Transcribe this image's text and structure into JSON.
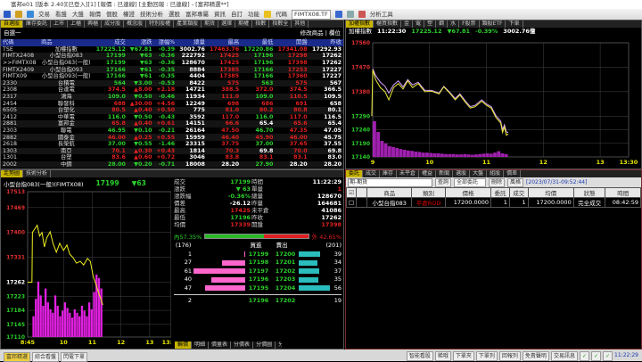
{
  "window": {
    "title": "富邦e01 [版本 2.40][已登入][1] [報價 : 已連線] [主動回報 : 已連線] - [富邦精選**]"
  },
  "toolbar": {
    "menus": [
      "交易",
      "看盤",
      "大盤",
      "報價",
      "個股",
      "權證",
      "技術分析",
      "選股",
      "富邦專屬",
      "資訊",
      "自訂",
      "功能"
    ],
    "code_label": "代碼",
    "code_value": "FIMTX08.TF",
    "analysis_tool": "分析工具"
  },
  "quote_panel": {
    "tabs": [
      "自選股",
      "庫存委託",
      "上市",
      "上櫃",
      "興櫃",
      "成分股",
      "概念股",
      "特別股權",
      "產業類股",
      "期貨",
      "選擇",
      "期權",
      "指數",
      "指數全",
      "其他"
    ],
    "group": "自選一",
    "edit_label": "修改商品",
    "col_label": "欄位",
    "columns": [
      "代碼",
      "商品",
      "成交",
      "漲跌",
      "漲幅%",
      "總量",
      "最高",
      "最低",
      "開盤",
      "昨收"
    ],
    "rows": [
      [
        "TSE",
        "加權指數",
        "17225.12",
        "▼67.81",
        "-0.39",
        "3002.76",
        "17463.76",
        "17220.86",
        "17341.08",
        "17292.93"
      ],
      [
        "FIMTX2408",
        "小型台指083",
        "17199",
        "▼63",
        "-0.36",
        "222792",
        "17425",
        "17196",
        "17298",
        "17262"
      ],
      [
        ">>FIMTX08",
        "小型台指083(一般)",
        "17199",
        "▼63",
        "-0.36",
        "128670",
        "17425",
        "17196",
        "17398",
        "17262"
      ],
      [
        "FIMTX2409",
        "小型台指093",
        "17166",
        "▼61",
        "-0.35",
        "8884",
        "17385",
        "17166",
        "17253",
        "17227"
      ],
      [
        "FIMTX09",
        "小型台指093(一般)",
        "17166",
        "▼61",
        "-0.35",
        "4404",
        "17385",
        "17166",
        "17360",
        "17227"
      ],
      [
        "2330",
        "台積電",
        "564",
        "▼3.00",
        "-0.53",
        "8422",
        "575",
        "563",
        "575",
        "567"
      ],
      [
        "2308",
        "台達電",
        "374.5",
        "▲8.00",
        "+2.18",
        "14721",
        "388.5",
        "372.0",
        "374.5",
        "366.5"
      ],
      [
        "2317",
        "鴻海",
        "109.0",
        "▼0.50",
        "-0.46",
        "11934",
        "111.0",
        "109.0",
        "110.5",
        "109.5"
      ],
      [
        "2454",
        "聯發科",
        "688",
        "▲30.00",
        "+4.56",
        "12249",
        "698",
        "686",
        "691",
        "658"
      ],
      [
        "6505",
        "台塑化",
        "80.5",
        "▲0.40",
        "+0.50",
        "775",
        "81.0",
        "80.2",
        "80.8",
        "80.1"
      ],
      [
        "2412",
        "中華電",
        "116.0",
        "▼0.50",
        "-0.43",
        "3592",
        "117.0",
        "116.0",
        "117.0",
        "116.5"
      ],
      [
        "2881",
        "富邦金",
        "65.8",
        "▲0.40",
        "+0.61",
        "14151",
        "66.6",
        "65.4",
        "65.6",
        "65.4"
      ],
      [
        "2303",
        "聯電",
        "46.95",
        "▼0.10",
        "-0.21",
        "26164",
        "47.50",
        "46.70",
        "47.35",
        "47.05"
      ],
      [
        "2882",
        "國泰金",
        "46.00",
        "▲0.25",
        "+0.55",
        "15959",
        "46.40",
        "45.90",
        "46.00",
        "45.75"
      ],
      [
        "2618",
        "長榮航",
        "37.00",
        "▼0.55",
        "-1.46",
        "23315",
        "37.75",
        "37.00",
        "37.65",
        "37.55"
      ],
      [
        "1303",
        "南亞",
        "70.1",
        "▲0.30",
        "+0.43",
        "1814",
        "70.3",
        "69.8",
        "70.0",
        "69.8"
      ],
      [
        "1301",
        "台塑",
        "83.6",
        "▲0.60",
        "+0.72",
        "3046",
        "83.8",
        "83.1",
        "83.1",
        "83.0"
      ],
      [
        "2002",
        "中鋼",
        "28.00",
        "▼0.20",
        "-0.71",
        "18008",
        "28.20",
        "27.90",
        "28.20",
        "28.20"
      ]
    ]
  },
  "index_panel": {
    "tabs": [
      "加權指數",
      "櫃買指數",
      "金",
      "電",
      "塑",
      "鋼",
      "水",
      "F股票",
      "類股ETF",
      "下單"
    ],
    "name": "加權指數",
    "time": "11:22:30",
    "price": "17225.12",
    "change": "▼67.81",
    "pct": "-0.39%",
    "volume": "3002.76億"
  },
  "detail_panel": {
    "tabs": [
      "走勢圖",
      "技術分析"
    ],
    "symbol": "小型台指083(一般)(FIMTX08)",
    "price": "17199",
    "change": "▼63",
    "fields": [
      [
        "成交",
        "17199",
        "時間",
        "11:22:29"
      ],
      [
        "漲跌",
        "▼ 63",
        "單量",
        "1"
      ],
      [
        "漲跌幅",
        "-0.36%",
        "總量",
        "128670"
      ],
      [
        "價差",
        "-26.12",
        "昨量",
        "164681"
      ],
      [
        "最高",
        "17425",
        "未平倉",
        "41086"
      ],
      [
        "最低",
        "17196",
        "昨收",
        "17262"
      ],
      [
        "均價",
        "17339",
        "開盤",
        "17398"
      ]
    ],
    "inner_pct": "內57.35%",
    "outer_pct": "外 42.65%",
    "inner_ratio": 57.35,
    "book_header": [
      "(176)",
      "買進",
      "賣出",
      "(201)"
    ],
    "book": [
      [
        "1",
        "17199",
        "17200",
        "39"
      ],
      [
        "27",
        "17198",
        "17201",
        "34"
      ],
      [
        "61",
        "17197",
        "17202",
        "37"
      ],
      [
        "40",
        "17196",
        "17203",
        "35"
      ],
      [
        "47",
        "17195",
        "17204",
        "56"
      ]
    ],
    "book_total": [
      "2",
      "17196",
      "17202",
      "19"
    ],
    "bottom_tabs": [
      "輪價",
      "明細",
      "價量表",
      "分價表",
      "分價圖",
      "分量表",
      "支撐壓力",
      "五"
    ]
  },
  "order_panel": {
    "tabs": [
      "委託",
      "成交",
      "庫存",
      "未平倉",
      "權益",
      "新聞",
      "選股",
      "大盤",
      "組股",
      "價差"
    ],
    "account_label": "期-期貨",
    "query": "查詢",
    "filter": "全部委託",
    "delete": "刪除",
    "style": "風格",
    "timestamp": "[2023/07/31-09:52:44]",
    "columns": [
      "商品",
      "類別",
      "價格",
      "委託",
      "成交",
      "均價",
      "狀態",
      "時間"
    ],
    "rows": [
      [
        "小型台指083",
        "平倉ROD",
        "17200.0000",
        "1",
        "1",
        "17200.0000",
        "完全成交",
        "08:42:59"
      ]
    ]
  },
  "status": {
    "tabs": [
      "富邦精選",
      "綜合看盤",
      "閃電下單"
    ],
    "buttons": [
      "智能看股",
      "稀哦",
      "下單夾",
      "下單列",
      "回報列",
      "免責聲明",
      "交易訊息"
    ],
    "clock": "11:22:29"
  },
  "chart_data": [
    {
      "type": "line",
      "panel": "index",
      "x_ticks": [
        "9",
        "10",
        "11",
        "12",
        "13",
        "13:30"
      ],
      "y_ticks": [
        17560,
        17470,
        17380,
        17290,
        17240,
        17190,
        17140
      ],
      "ylim": [
        17140,
        17560
      ],
      "prev_close": 17292.93,
      "series": [
        {
          "color": "#e8e83a",
          "points": [
            [
              "8:59",
              17290
            ],
            [
              "9:00",
              17460
            ],
            [
              "9:03",
              17425
            ],
            [
              "9:08",
              17395
            ],
            [
              "9:13",
              17380
            ],
            [
              "9:17",
              17350
            ],
            [
              "9:22",
              17395
            ],
            [
              "9:27",
              17410
            ],
            [
              "9:32",
              17390
            ],
            [
              "9:37",
              17420
            ],
            [
              "9:42",
              17395
            ],
            [
              "9:48",
              17410
            ],
            [
              "9:55",
              17380
            ],
            [
              "10:02",
              17382
            ],
            [
              "10:10",
              17372
            ],
            [
              "10:15",
              17398
            ],
            [
              "10:22",
              17372
            ],
            [
              "10:27",
              17350
            ],
            [
              "10:32",
              17368
            ],
            [
              "10:38",
              17340
            ],
            [
              "10:43",
              17320
            ],
            [
              "10:48",
              17325
            ],
            [
              "10:55",
              17345
            ],
            [
              "11:00",
              17330
            ],
            [
              "11:05",
              17320
            ],
            [
              "11:10",
              17285
            ],
            [
              "11:15",
              17265
            ],
            [
              "11:17",
              17230
            ],
            [
              "11:19",
              17250
            ],
            [
              "11:21",
              17220
            ],
            [
              "11:23",
              17225
            ]
          ]
        },
        {
          "color": "#d9a3ff",
          "points": [
            [
              "9:00",
              17465
            ],
            [
              "9:03",
              17440
            ],
            [
              "9:08",
              17415
            ],
            [
              "9:13",
              17400
            ],
            [
              "9:17",
              17375
            ],
            [
              "9:22",
              17405
            ],
            [
              "9:27",
              17420
            ],
            [
              "9:32",
              17398
            ],
            [
              "9:37",
              17425
            ],
            [
              "9:42",
              17405
            ],
            [
              "9:48",
              17415
            ],
            [
              "9:55",
              17385
            ],
            [
              "10:02",
              17385
            ],
            [
              "10:10",
              17375
            ],
            [
              "10:15",
              17400
            ],
            [
              "10:22",
              17375
            ],
            [
              "10:27",
              17355
            ],
            [
              "10:32",
              17372
            ],
            [
              "10:38",
              17345
            ],
            [
              "10:43",
              17325
            ],
            [
              "10:48",
              17330
            ],
            [
              "10:55",
              17350
            ],
            [
              "11:00",
              17335
            ],
            [
              "11:05",
              17325
            ],
            [
              "11:10",
              17292
            ],
            [
              "11:15",
              17272
            ],
            [
              "11:17",
              17240
            ],
            [
              "11:19",
              17258
            ],
            [
              "11:21",
              17232
            ],
            [
              "11:23",
              17230
            ]
          ]
        }
      ],
      "volume": [
        100,
        70,
        45,
        38,
        30,
        28,
        25,
        22,
        20,
        18,
        17,
        15,
        14,
        12,
        12,
        11,
        10,
        10,
        9,
        8,
        8,
        8,
        7,
        7,
        8,
        7,
        6,
        7,
        8,
        9,
        10,
        9,
        12,
        16,
        10,
        8
      ]
    },
    {
      "type": "line",
      "panel": "detail",
      "x_ticks": [
        "8:45",
        "10",
        "11",
        "12",
        "13",
        "13:45"
      ],
      "y_ticks": [
        17513,
        17469,
        17400,
        17331,
        17262,
        17223,
        17184,
        17145,
        17110
      ],
      "ylim": [
        17110,
        17513
      ],
      "prev_close": 17262,
      "series": [
        {
          "color": "#f0f020",
          "points": [
            [
              "8:45",
              17262
            ],
            [
              "8:54",
              17262
            ],
            [
              "8:55",
              17400
            ],
            [
              "9:00",
              17410
            ],
            [
              "9:05",
              17420
            ],
            [
              "9:10",
              17390
            ],
            [
              "9:15",
              17400
            ],
            [
              "9:20",
              17360
            ],
            [
              "9:25",
              17385
            ],
            [
              "9:32",
              17402
            ],
            [
              "9:38",
              17370
            ],
            [
              "9:45",
              17345
            ],
            [
              "9:52",
              17370
            ],
            [
              "10:00",
              17350
            ],
            [
              "10:07",
              17365
            ],
            [
              "10:13",
              17340
            ],
            [
              "10:20",
              17330
            ],
            [
              "10:27",
              17315
            ],
            [
              "10:35",
              17320
            ],
            [
              "10:42",
              17310
            ],
            [
              "10:50",
              17328
            ],
            [
              "10:56",
              17320
            ],
            [
              "11:02",
              17278
            ],
            [
              "11:08",
              17255
            ],
            [
              "11:14",
              17230
            ],
            [
              "11:18",
              17215
            ],
            [
              "11:22",
              17199
            ]
          ]
        }
      ],
      "volume": [
        30,
        55,
        80,
        60,
        45,
        70,
        50,
        40,
        35,
        60,
        45,
        30,
        38,
        50,
        42,
        35,
        28,
        40,
        35,
        30,
        45,
        38,
        30,
        50,
        40,
        65,
        90,
        85,
        70
      ]
    }
  ]
}
